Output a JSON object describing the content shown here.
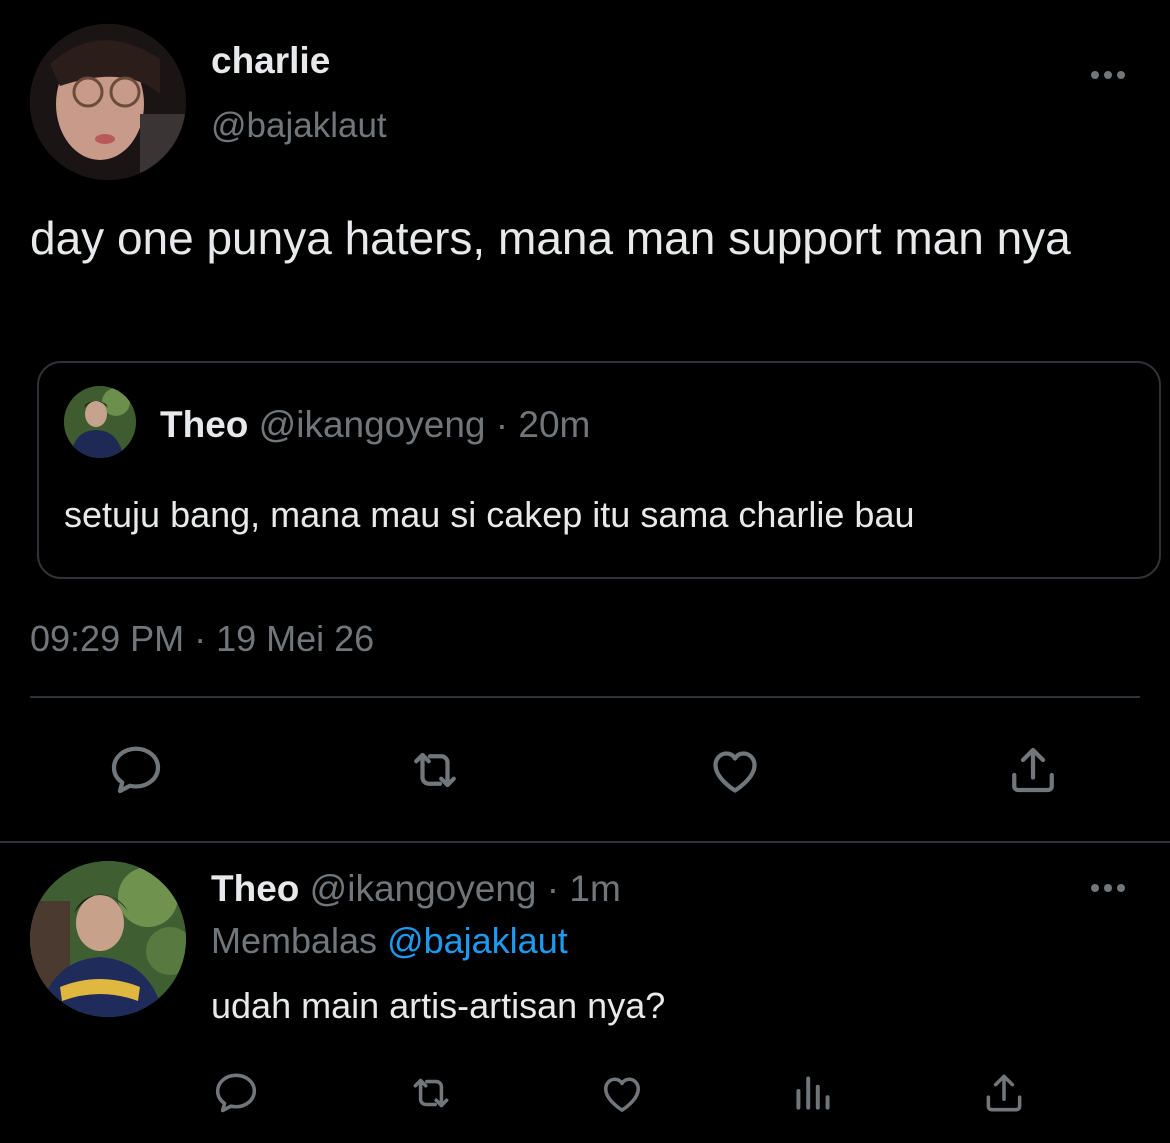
{
  "colors": {
    "background": "#000000",
    "primary_text": "#e7e9ea",
    "secondary_text": "#71767b",
    "border": "#2f3336",
    "link": "#1d9bf0"
  },
  "main_tweet": {
    "display_name": "charlie",
    "handle": "@bajaklaut",
    "text": "day one punya haters, mana man support man nya",
    "timestamp": "09:29 PM · 19 Mei 26",
    "more_icon": "more-horizontal-icon",
    "quote": {
      "display_name": "Theo",
      "handle": "@ikangoyeng",
      "separator": "·",
      "time_ago": "20m",
      "text": "setuju bang, mana mau si cakep itu sama charlie bau"
    },
    "actions": [
      {
        "icon": "reply-icon"
      },
      {
        "icon": "retweet-icon"
      },
      {
        "icon": "like-icon"
      },
      {
        "icon": "share-icon"
      }
    ]
  },
  "reply_tweet": {
    "display_name": "Theo",
    "handle": "@ikangoyeng",
    "separator": "·",
    "time_ago": "1m",
    "replying_label": "Membalas",
    "replying_to": "@bajaklaut",
    "text": "udah main artis-artisan nya?",
    "more_icon": "more-horizontal-icon",
    "actions": [
      {
        "icon": "reply-icon"
      },
      {
        "icon": "retweet-icon"
      },
      {
        "icon": "like-icon"
      },
      {
        "icon": "analytics-icon"
      },
      {
        "icon": "share-icon"
      }
    ]
  }
}
